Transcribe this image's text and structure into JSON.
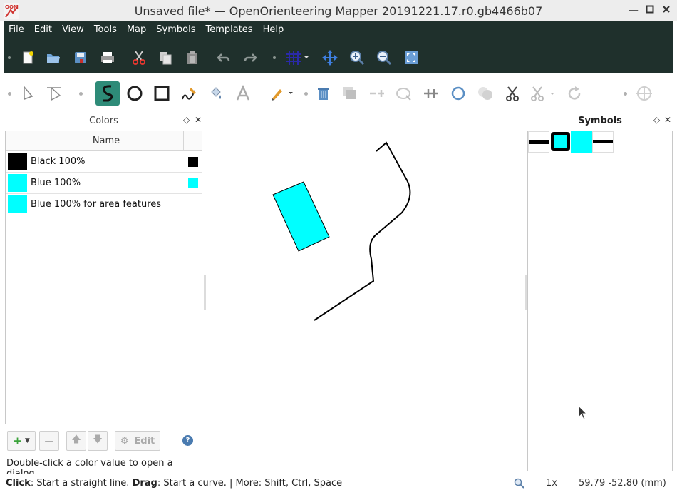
{
  "window": {
    "title": "Unsaved file* — OpenOrienteering Mapper 20191221.17.r0.gb4466b07",
    "app_icon_text": "OOM"
  },
  "menu": [
    "File",
    "Edit",
    "View",
    "Tools",
    "Map",
    "Symbols",
    "Templates",
    "Help"
  ],
  "toolbar_icons": [
    "new-file-icon",
    "open-icon",
    "save-icon",
    "print-icon",
    "cut-icon",
    "copy-icon",
    "paste-icon",
    "undo-icon",
    "redo-icon",
    "grid-icon",
    "pan-icon",
    "zoom-in-icon",
    "zoom-out-icon",
    "fit-icon"
  ],
  "edit_tools": [
    "edit-point-icon",
    "edit-line-icon",
    "draw-path-icon",
    "draw-circle-icon",
    "draw-rectangle-icon",
    "draw-freehand-icon",
    "fill-icon",
    "text-icon",
    "paint-icon",
    "delete-icon",
    "duplicate-icon",
    "switch-dash-icon",
    "cutout-icon",
    "cut-hole-icon",
    "convert-circle-icon",
    "boolean-icon",
    "cut-icon",
    "cut-dropdown-icon",
    "rotate-icon",
    "measure-icon"
  ],
  "colors_panel": {
    "title": "Colors",
    "column_name": "Name",
    "rows": [
      {
        "name": "Black 100%",
        "color": "#000000",
        "mini": true
      },
      {
        "name": "Blue 100%",
        "color": "#00ffff",
        "mini": true
      },
      {
        "name": "Blue 100% for area features",
        "color": "#00ffff",
        "mini": false
      }
    ],
    "edit_label": "Edit",
    "hint": "Double-click a color value to open a dialog."
  },
  "symbols_panel": {
    "title": "Symbols"
  },
  "status": {
    "click_key": "Click",
    "click_text": ": Start a straight line. ",
    "drag_key": "Drag",
    "drag_text": ": Start a curve. | More: Shift, Ctrl, Space",
    "zoom": "1x",
    "coords": "59.79 -52.80 (mm)"
  },
  "colors": {
    "accent_dark": "#1f302c",
    "cyan": "#00ffff",
    "active_tool": "#2e8b78"
  }
}
